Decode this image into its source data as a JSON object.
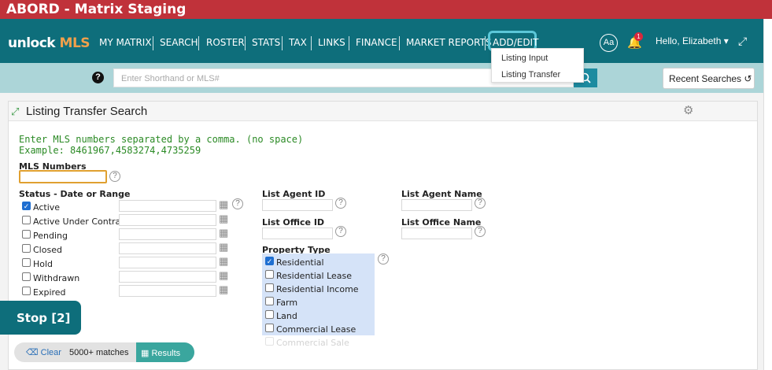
{
  "window": {
    "title": "ABORD - Matrix Staging"
  },
  "nav": {
    "logo_unlock": "unlock",
    "logo_mls": "MLS",
    "items": [
      "MY MATRIX",
      "SEARCH",
      "ROSTER",
      "STATS",
      "TAX",
      "LINKS",
      "FINANCE",
      "MARKET REPORTS",
      "ADD/EDIT"
    ],
    "aa": "Aa",
    "notification_count": "1",
    "user": "Hello, Elizabeth"
  },
  "dropdown": {
    "items": [
      "Listing Input",
      "Listing Transfer"
    ]
  },
  "search": {
    "placeholder": "Enter Shorthand or MLS#",
    "recent_label": "Recent Searches"
  },
  "panel": {
    "title": "Listing Transfer Search",
    "instructions": "Enter MLS numbers separated by a comma. (no space)",
    "example": "Example: 8461967,4583274,4735259"
  },
  "form": {
    "mls_numbers_label": "MLS Numbers",
    "mls_numbers_value": "",
    "status_label": "Status - Date or Range",
    "statuses": [
      {
        "label": "Active",
        "checked": true
      },
      {
        "label": "Active Under Contract",
        "checked": false
      },
      {
        "label": "Pending",
        "checked": false
      },
      {
        "label": "Closed",
        "checked": false
      },
      {
        "label": "Hold",
        "checked": false
      },
      {
        "label": "Withdrawn",
        "checked": false
      },
      {
        "label": "Expired",
        "checked": false
      }
    ],
    "list_agent_id_label": "List Agent ID",
    "list_agent_name_label": "List Agent Name",
    "list_office_id_label": "List Office ID",
    "list_office_name_label": "List Office Name",
    "property_type_label": "Property Type",
    "property_types": [
      {
        "label": "Residential",
        "checked": true
      },
      {
        "label": "Residential Lease",
        "checked": false
      },
      {
        "label": "Residential Income",
        "checked": false
      },
      {
        "label": "Farm",
        "checked": false
      },
      {
        "label": "Land",
        "checked": false
      },
      {
        "label": "Commercial Lease",
        "checked": false
      },
      {
        "label": "Commercial Sale",
        "checked": false
      }
    ]
  },
  "overlay": {
    "stop_label": "Stop [2]"
  },
  "footer": {
    "clear_label": "Clear",
    "matches": "5000+ matches",
    "results_label": "Results"
  },
  "colors": {
    "title_bar": "#c0323a",
    "nav_bg": "#0e6e7b",
    "logo_accent": "#f0a04b",
    "search_band": "#acd5d8",
    "instructions_green": "#2b8a25",
    "property_box": "#d5e3f8",
    "results_btn": "#3aa69e"
  }
}
